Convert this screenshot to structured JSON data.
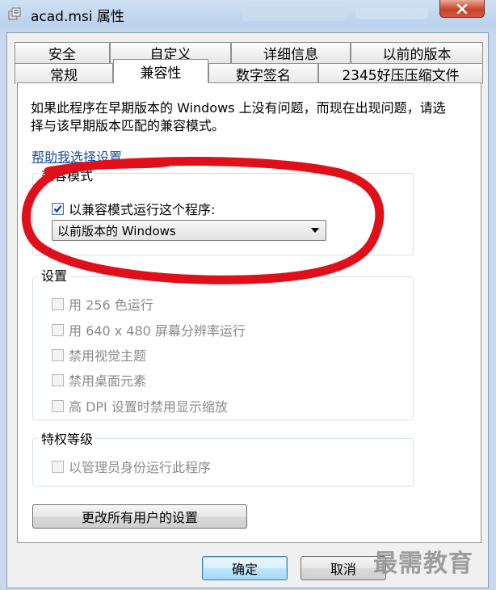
{
  "window": {
    "title": "acad.msi 属性"
  },
  "tabs_row1": [
    {
      "label": "安全"
    },
    {
      "label": "自定义"
    },
    {
      "label": "详细信息"
    },
    {
      "label": "以前的版本"
    }
  ],
  "tabs_row2": [
    {
      "label": "常规"
    },
    {
      "label": "兼容性",
      "active": true
    },
    {
      "label": "数字签名"
    },
    {
      "label": "2345好压压缩文件"
    }
  ],
  "description": "如果此程序在早期版本的 Windows 上没有问题，而现在出现问题，请选择与该早期版本匹配的兼容模式。",
  "help_link": "帮助我选择设置",
  "compat_group": {
    "label": "兼容模式",
    "checkbox_label": "以兼容模式运行这个程序:",
    "checked": true,
    "selected_os": "以前版本的 Windows"
  },
  "settings_group": {
    "label": "设置",
    "items": [
      {
        "label": "用 256 色运行",
        "checked": false,
        "enabled": false
      },
      {
        "label": "用 640 x 480 屏幕分辨率运行",
        "checked": false,
        "enabled": false
      },
      {
        "label": "禁用视觉主题",
        "checked": false,
        "enabled": false
      },
      {
        "label": "禁用桌面元素",
        "checked": false,
        "enabled": false
      },
      {
        "label": "高 DPI 设置时禁用显示缩放",
        "checked": false,
        "enabled": false
      }
    ]
  },
  "privilege_group": {
    "label": "特权等级",
    "item": {
      "label": "以管理员身份运行此程序",
      "checked": false,
      "enabled": false
    }
  },
  "buttons": {
    "change_all": "更改所有用户的设置",
    "ok": "确定",
    "cancel": "取消"
  },
  "watermark": "最需教育",
  "colors": {
    "annotation_red": "#e0101a",
    "link_blue": "#1a4fa0",
    "disabled_text": "#8a8a8a"
  }
}
